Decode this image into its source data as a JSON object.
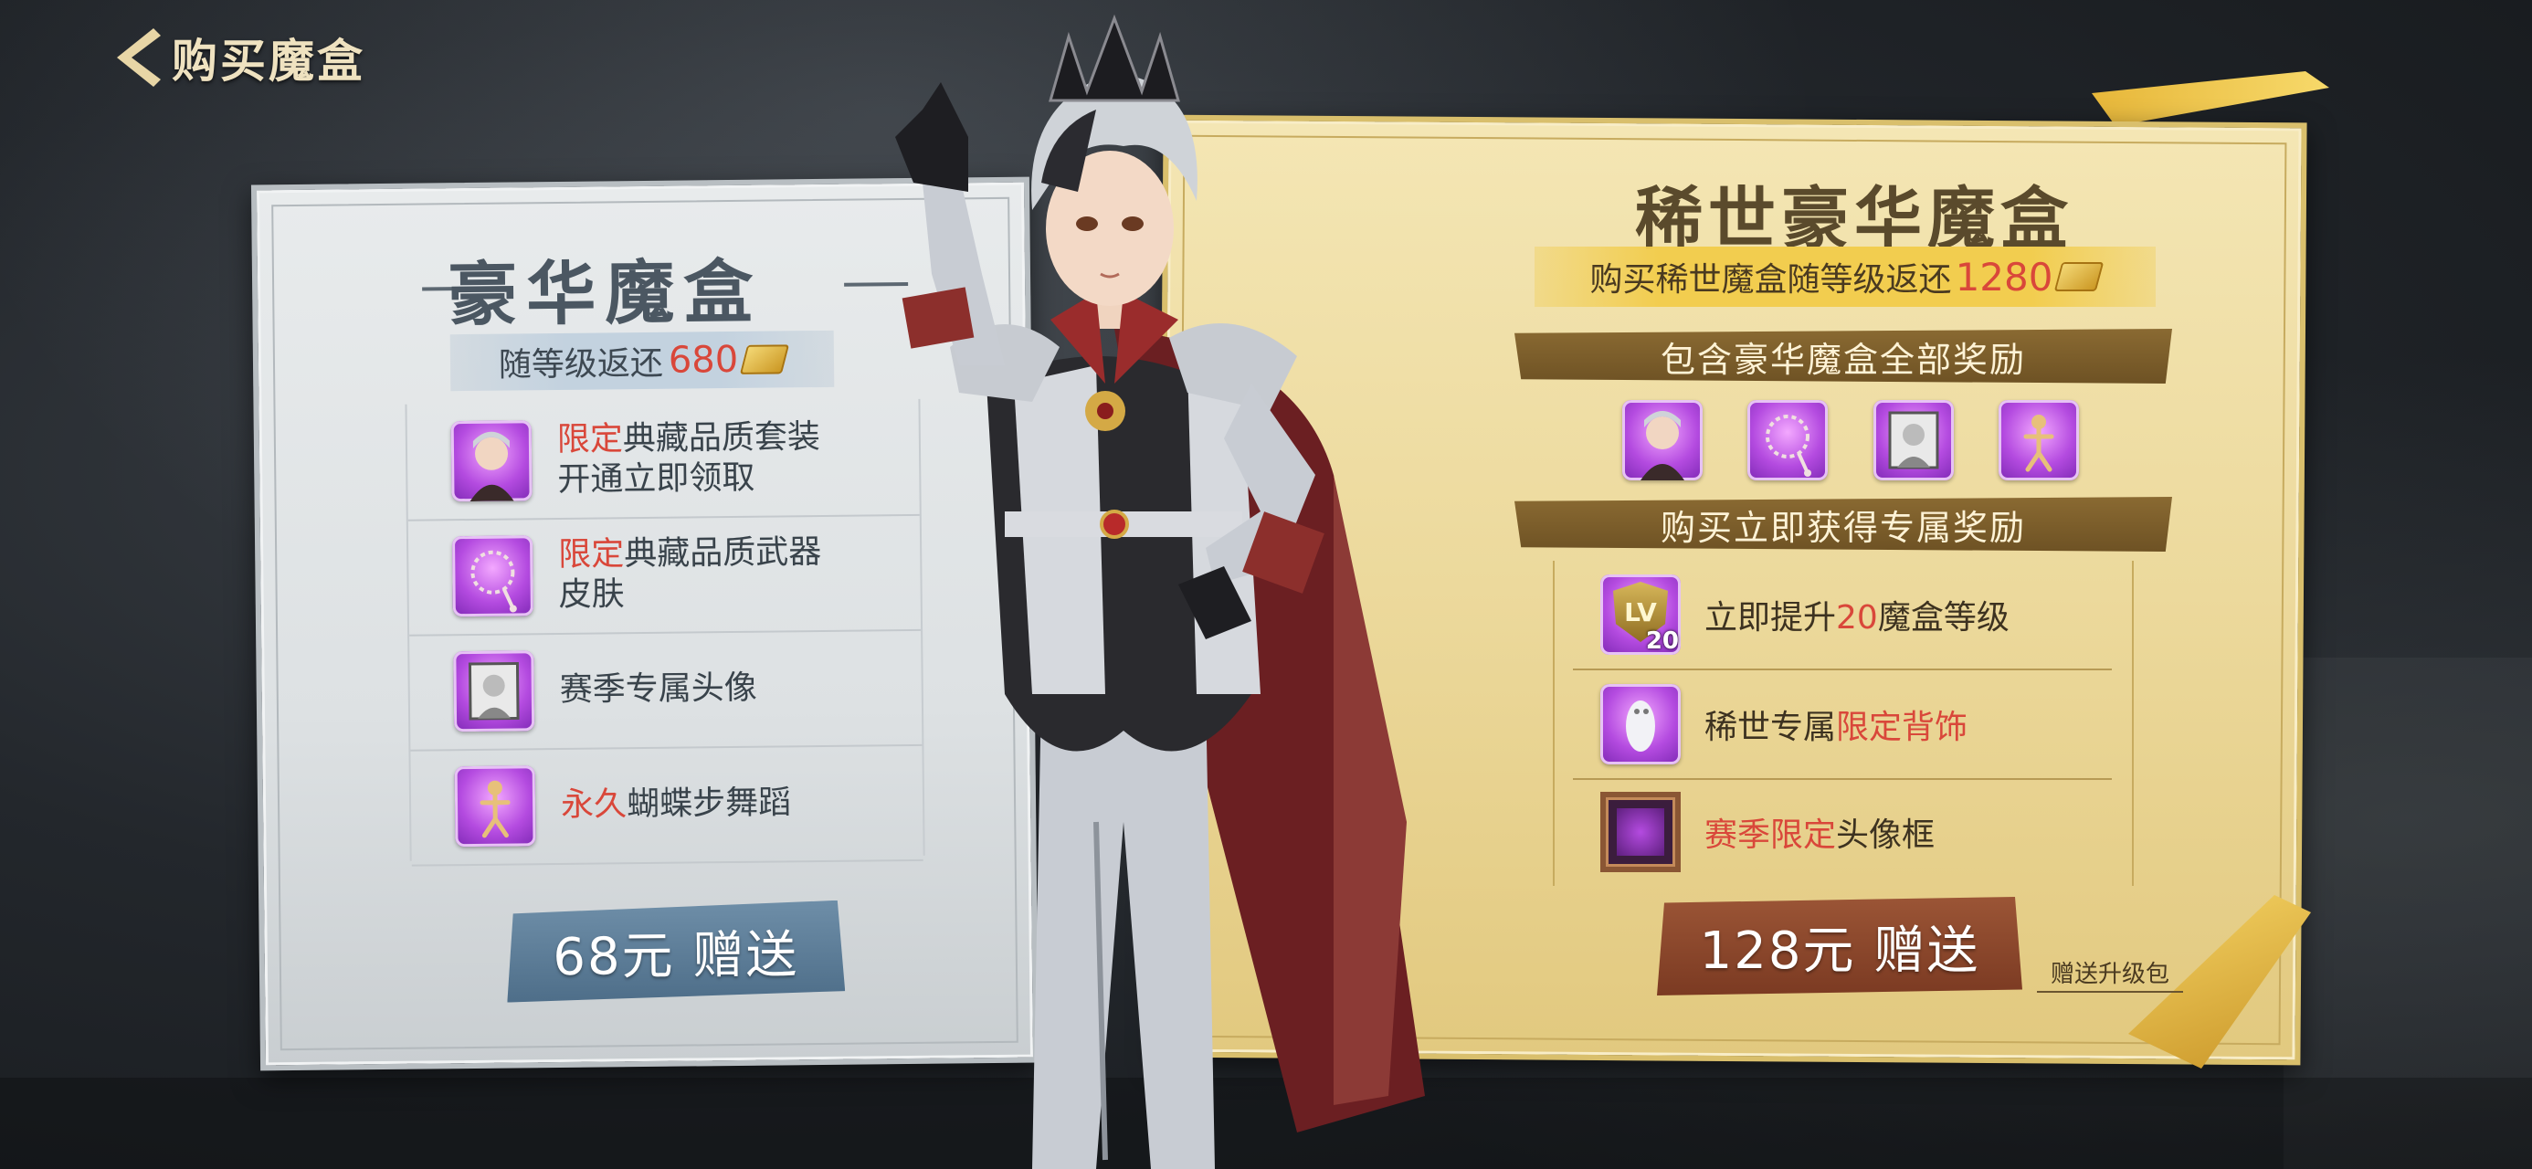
{
  "header": {
    "title": "购买魔盒"
  },
  "left_box": {
    "title": "豪华魔盒",
    "rebate_prefix": "随等级返还",
    "rebate_amount": "680",
    "items": [
      {
        "highlight": "限定",
        "text_line1": "典藏品质套装",
        "text_line2": "开通立即领取",
        "icon": "character-portrait-icon"
      },
      {
        "highlight": "限定",
        "text_line1": "典藏品质武器",
        "text_line2": "皮肤",
        "icon": "rosary-weapon-icon"
      },
      {
        "highlight": "",
        "text_line1": "赛季专属头像",
        "text_line2": "",
        "icon": "avatar-portrait-icon"
      },
      {
        "highlight": "永久",
        "text_line1": "蝴蝶步舞蹈",
        "text_line2": "",
        "icon": "dance-emote-icon"
      }
    ],
    "buy_label": "68元 赠送"
  },
  "right_box": {
    "title": "稀世豪华魔盒",
    "rebate_prefix": "购买稀世魔盒随等级返还",
    "rebate_amount": "1280",
    "banner_all_rewards": "包含豪华魔盒全部奖励",
    "banner_exclusive": "购买立即获得专属奖励",
    "preview_icons": [
      "character-portrait-icon",
      "rosary-weapon-icon",
      "avatar-portrait-icon",
      "dance-emote-icon"
    ],
    "rewards": [
      {
        "prefix": "立即提升",
        "highlight": "20",
        "suffix": "魔盒等级",
        "icon": "level-up-icon",
        "lv_label": "LV",
        "lv_num": "20"
      },
      {
        "prefix": "稀世专属",
        "highlight": "限定背饰",
        "suffix": "",
        "icon": "back-accessory-icon"
      },
      {
        "prefix": "",
        "highlight": "赛季限定",
        "suffix": "头像框",
        "icon": "avatar-frame-icon"
      }
    ],
    "buy_label": "128元 赠送",
    "upgrade_link": "赠送升级包"
  },
  "colors": {
    "highlight": "#d9473a",
    "left_panel": "#e8ebec",
    "right_panel": "#f4e6b4",
    "left_button": "#5a7b96",
    "right_button": "#8b4629"
  }
}
